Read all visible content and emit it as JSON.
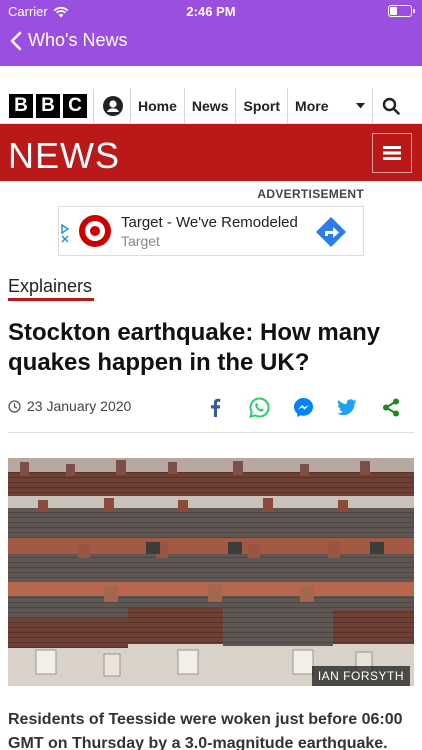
{
  "status_bar": {
    "carrier": "Carrier",
    "time": "2:46 PM"
  },
  "app_nav": {
    "back_label": "Who's News",
    "color": "#9b4fe0"
  },
  "bbc_bar": {
    "logo_letters": [
      "B",
      "B",
      "C"
    ],
    "nav": {
      "home": "Home",
      "news": "News",
      "sport": "Sport",
      "more": "More"
    }
  },
  "news_banner": {
    "wordmark": "NEWS",
    "color": "#bb1919"
  },
  "ad": {
    "label": "ADVERTISEMENT",
    "title": "Target - We've Remodeled",
    "advertiser": "Target",
    "brand_color": "#cc0000",
    "cta_color": "#2b7de9"
  },
  "article": {
    "section": "Explainers",
    "headline": "Stockton earthquake: How many quakes happen in the UK?",
    "date": "23 January 2020",
    "share_icons": [
      "facebook-icon",
      "whatsapp-icon",
      "messenger-icon",
      "twitter-icon",
      "share-icon"
    ],
    "photo_credit": "IAN FORSYTH",
    "lede": "Residents of Teesside were woken just before 06:00 GMT on Thursday by a 3.0-magnitude earthquake."
  }
}
